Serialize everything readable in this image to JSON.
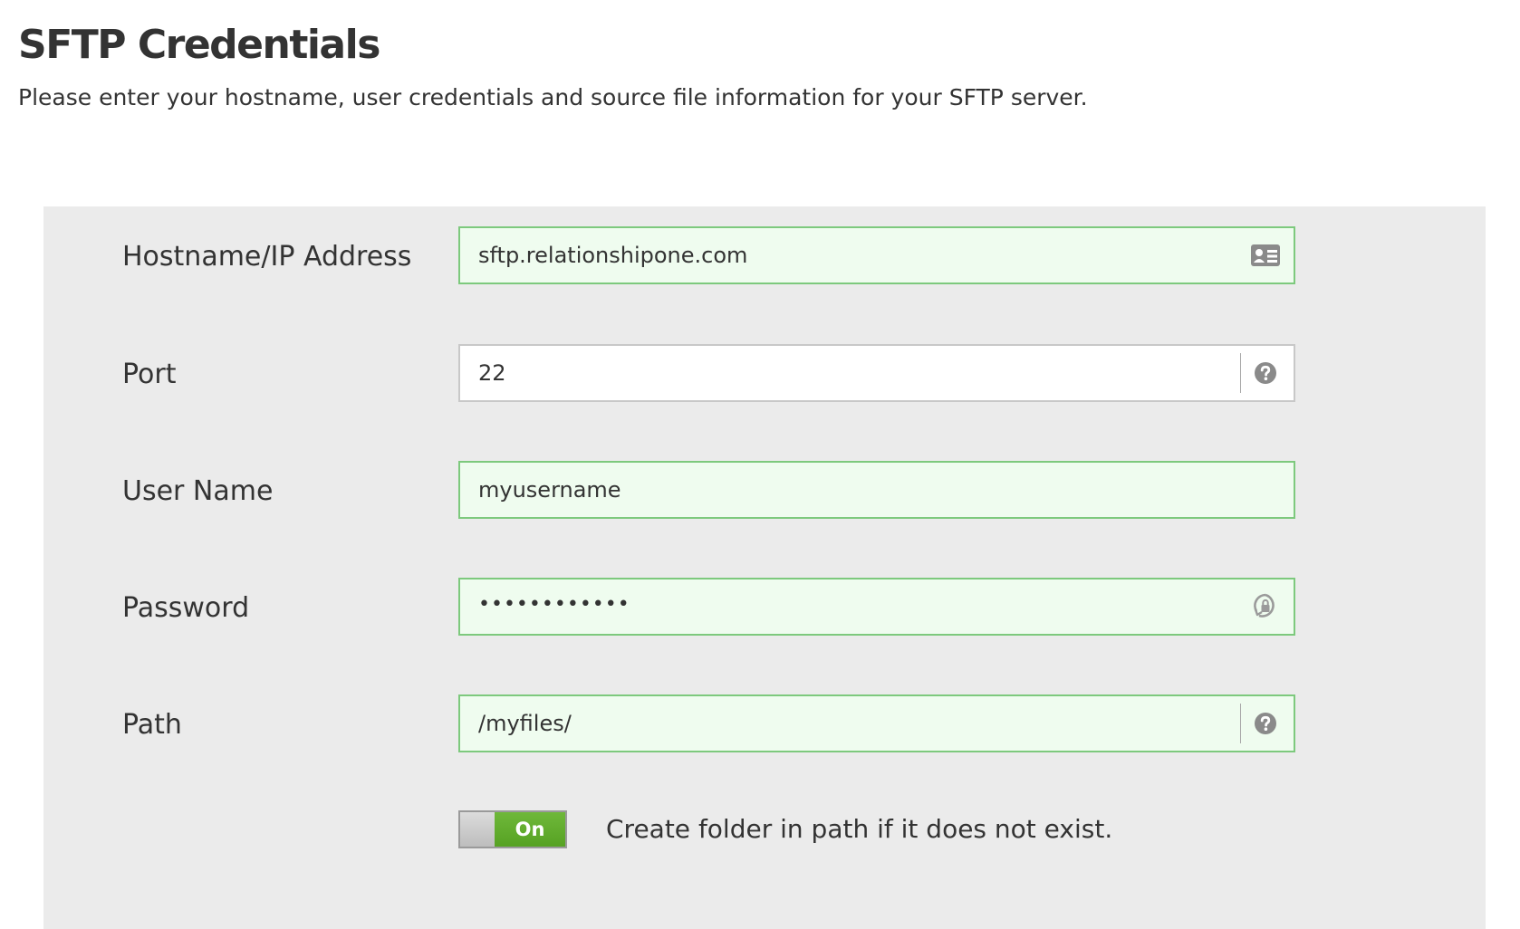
{
  "header": {
    "title": "SFTP Credentials",
    "subtitle": "Please enter your hostname, user credentials and source file information for your SFTP server."
  },
  "form": {
    "hostname": {
      "label": "Hostname/IP Address",
      "value": "sftp.relationshipone.com",
      "icon": "contact-card-icon",
      "state": "valid"
    },
    "port": {
      "label": "Port",
      "value": "22",
      "icon": "help-icon",
      "state": "neutral"
    },
    "username": {
      "label": "User Name",
      "value": "myusername",
      "state": "valid"
    },
    "password": {
      "label": "Password",
      "value": "••••••••••••",
      "icon": "password-manager-icon",
      "state": "valid"
    },
    "path": {
      "label": "Path",
      "value": "/myfiles/",
      "icon": "help-icon",
      "state": "valid"
    },
    "create_folder": {
      "toggle_label": "On",
      "toggle_state": "on",
      "text": "Create folder in path if it does not exist."
    }
  },
  "colors": {
    "valid_border": "#7dc97d",
    "valid_background": "#effcef",
    "toggle_on": "#5faa2b",
    "panel_background": "#ebebeb"
  }
}
